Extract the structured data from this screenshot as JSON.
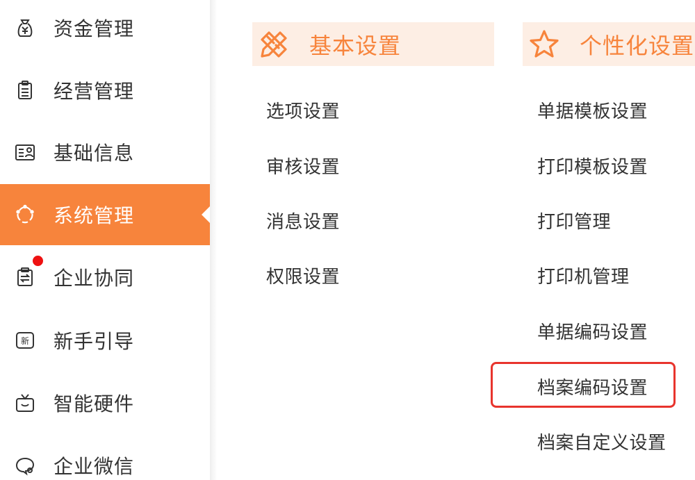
{
  "colors": {
    "accent": "#f7843c",
    "header_bg": "#fdeee4",
    "highlight_border": "#e8342d",
    "notification_dot": "#ee1111"
  },
  "sidebar": {
    "items": [
      {
        "label": "资金管理",
        "icon": "money-bag-icon"
      },
      {
        "label": "经营管理",
        "icon": "clipboard-icon"
      },
      {
        "label": "基础信息",
        "icon": "contact-card-icon"
      },
      {
        "label": "系统管理",
        "icon": "system-circle-icon",
        "active": true
      },
      {
        "label": "企业协同",
        "icon": "sync-clipboard-icon",
        "badge": "red-dot"
      },
      {
        "label": "新手引导",
        "icon": "new-badge-icon"
      },
      {
        "label": "智能硬件",
        "icon": "tv-device-icon"
      },
      {
        "label": "企业微信",
        "icon": "chat-bubble-icon"
      }
    ]
  },
  "main": {
    "basic": {
      "title": "基本设置",
      "icon": "pencil-ruler-icon",
      "links": [
        "选项设置",
        "审核设置",
        "消息设置",
        "权限设置"
      ]
    },
    "personal": {
      "title": "个性化设置",
      "icon": "star-icon",
      "links": [
        "单据模板设置",
        "打印模板设置",
        "打印管理",
        "打印机管理",
        "单据编码设置",
        "档案编码设置",
        "档案自定义设置"
      ],
      "highlighted": "档案编码设置"
    }
  }
}
